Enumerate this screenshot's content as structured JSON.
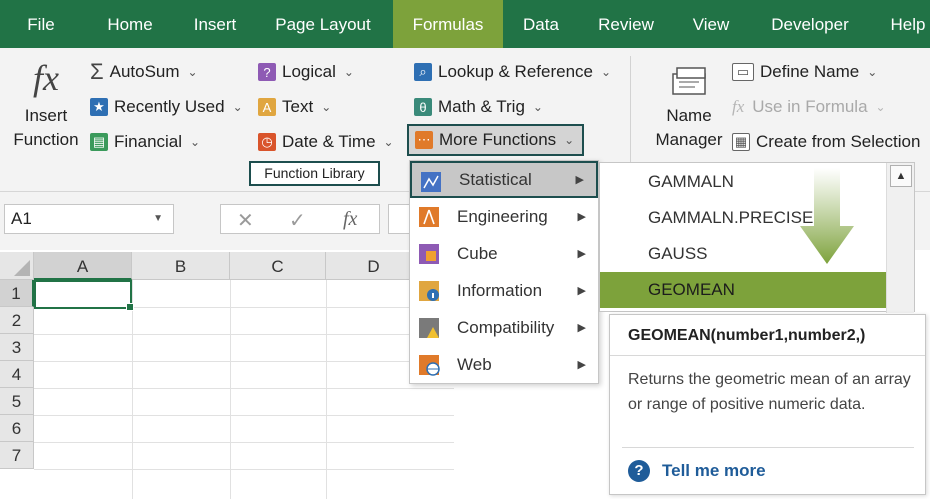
{
  "tabs": [
    "File",
    "Home",
    "Insert",
    "Page Layout",
    "Formulas",
    "Data",
    "Review",
    "View",
    "Developer",
    "Help"
  ],
  "active_tab": "Formulas",
  "ribbon": {
    "insert_function": {
      "icon": "fx",
      "line1": "Insert",
      "line2": "Function"
    },
    "col1": {
      "autosum": "AutoSum",
      "recently_used": "Recently Used",
      "financial": "Financial"
    },
    "col2": {
      "logical": "Logical",
      "text": "Text",
      "date_time": "Date & Time"
    },
    "col3": {
      "lookup": "Lookup & Reference",
      "math": "Math & Trig",
      "more": "More Functions"
    },
    "group_label": "Function Library",
    "name_manager": {
      "line1": "Name",
      "line2": "Manager"
    },
    "defined_names": {
      "define_name": "Define Name",
      "use_in_formula": "Use in Formula",
      "create_from_selection": "Create from Selection"
    }
  },
  "formula_bar": {
    "name_box": "A1",
    "fx": "fx"
  },
  "grid": {
    "columns": [
      "A",
      "B",
      "C",
      "D"
    ],
    "rows": [
      "1",
      "2",
      "3",
      "4",
      "5",
      "6",
      "7"
    ],
    "active_cell": "A1"
  },
  "more_functions_menu": [
    {
      "label": "Statistical",
      "icon_color": "#4472c4",
      "highlighted": true
    },
    {
      "label": "Engineering",
      "icon_color": "#e07a2a",
      "highlighted": false
    },
    {
      "label": "Cube",
      "icon_color": "#8e5ab4",
      "highlighted": false
    },
    {
      "label": "Information",
      "icon_color": "#e0a640",
      "highlighted": false
    },
    {
      "label": "Compatibility",
      "icon_color": "#7a7a7a",
      "highlighted": false
    },
    {
      "label": "Web",
      "icon_color": "#e07a2a",
      "highlighted": false
    }
  ],
  "function_list": [
    "GAMMALN",
    "GAMMALN.PRECISE",
    "GAUSS",
    "GEOMEAN"
  ],
  "selected_function": "GEOMEAN",
  "tooltip": {
    "title": "GEOMEAN(number1,number2,)",
    "description": "Returns the geometric mean of an array or range of positive numeric data.",
    "link": "Tell me more"
  },
  "colors": {
    "excel_green": "#217346",
    "accent_green": "#7da23b",
    "highlight_border": "#1d4e4e"
  }
}
